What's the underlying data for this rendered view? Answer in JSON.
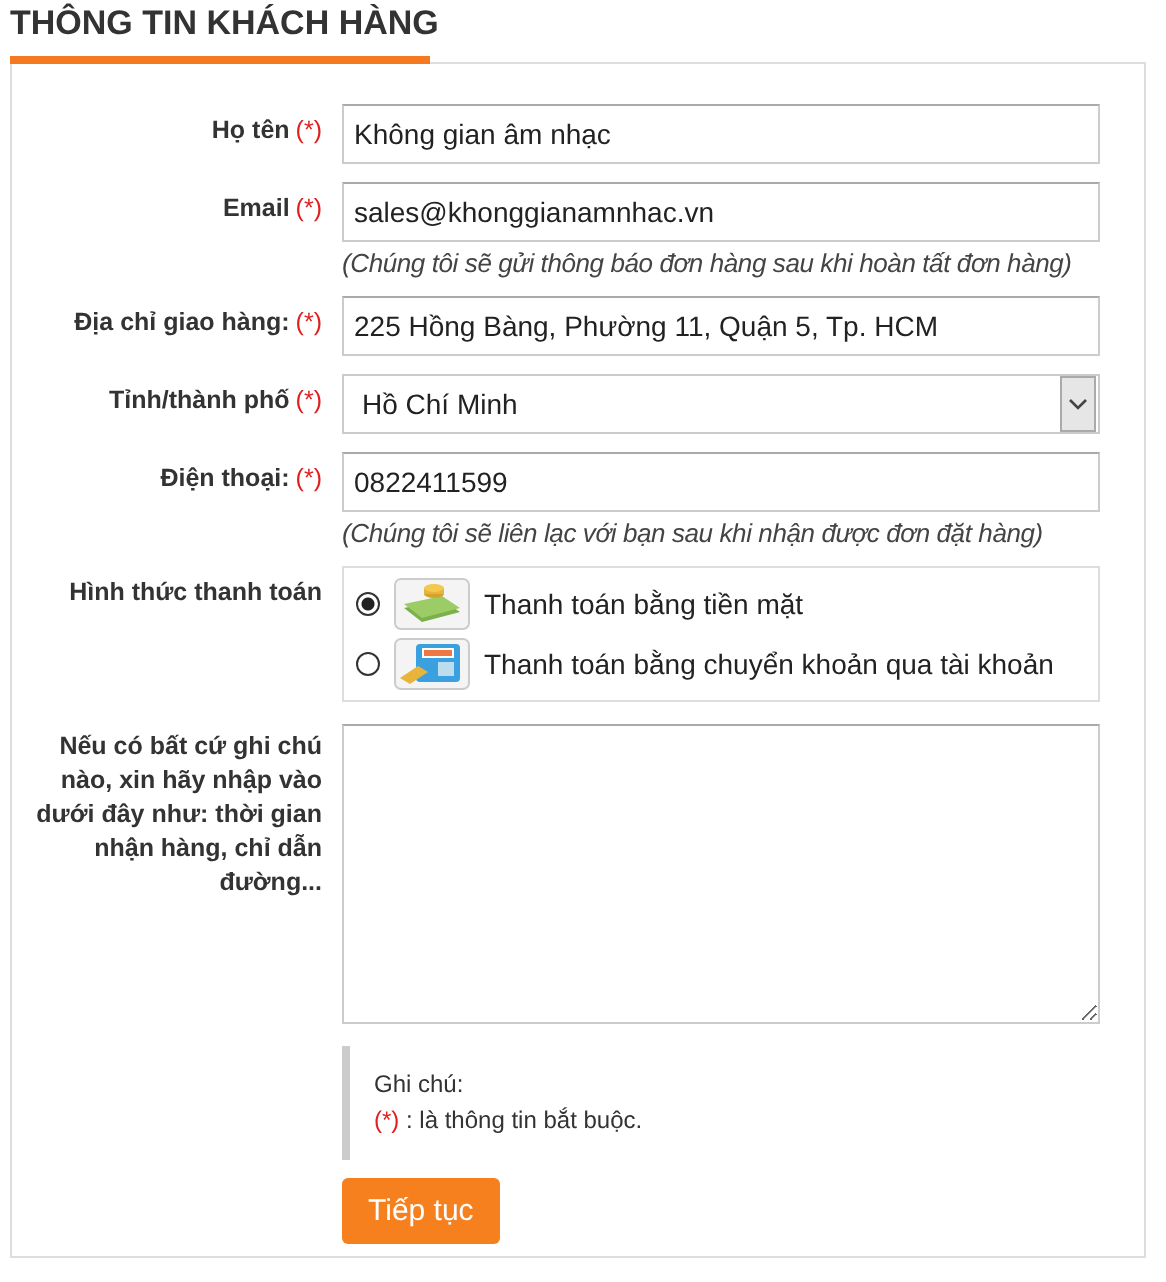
{
  "title": "THÔNG TIN KHÁCH HÀNG",
  "fields": [
    {
      "kind": "text",
      "label": "Họ tên",
      "required": true,
      "value": "Không gian âm nhạc"
    },
    {
      "kind": "text",
      "label": "Email",
      "required": true,
      "value": "sales@khonggianamnhac.vn",
      "hint": "(Chúng tôi sẽ gửi thông báo đơn hàng sau khi hoàn tất đơn hàng)"
    },
    {
      "kind": "text",
      "label": "Địa chỉ giao hàng:",
      "required": true,
      "value": "225 Hồng Bàng, Phường 11, Quận 5, Tp. HCM"
    },
    {
      "kind": "select",
      "label": "Tỉnh/thành phố",
      "required": true,
      "value": "Hồ Chí Minh"
    },
    {
      "kind": "text",
      "label": "Điện thoại:",
      "required": true,
      "value": "0822411599",
      "hint": "(Chúng tôi sẽ liên lạc với bạn sau khi nhận được đơn đặt hàng)"
    }
  ],
  "required_mark": "(*)",
  "payment": {
    "label": "Hình thức thanh toán",
    "options": [
      {
        "kind": "cash",
        "label": "Thanh toán bằng tiền mặt",
        "selected": true
      },
      {
        "kind": "atm",
        "label": "Thanh toán bằng chuyển khoản qua tài khoản",
        "selected": false
      }
    ]
  },
  "notes": {
    "label": "Nếu có bất cứ ghi chú nào, xin hãy nhập vào dưới đây như: thời gian nhận hàng, chỉ dẫn đường..."
  },
  "legend": {
    "title": "Ghi chú:",
    "mark": "(*)",
    "text": ": là thông tin bắt buộc."
  },
  "submit": "Tiếp tục"
}
